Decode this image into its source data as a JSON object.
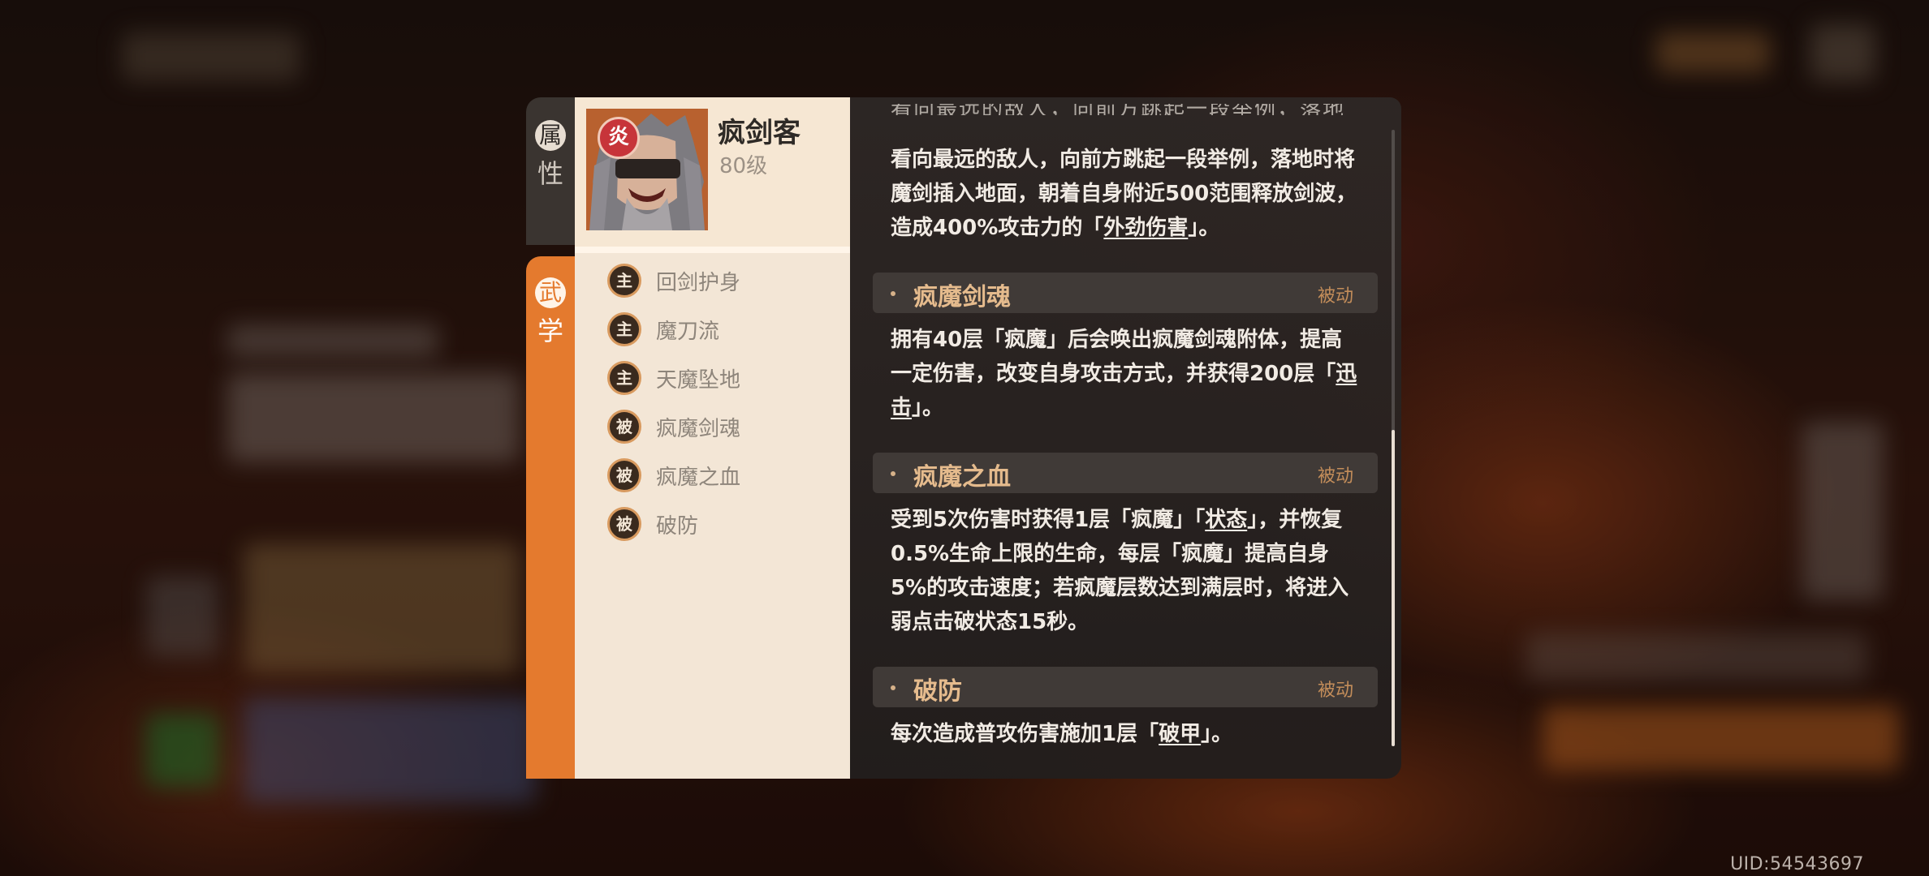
{
  "tabs": {
    "attributes": {
      "char1": "属",
      "char2": "性"
    },
    "martial": {
      "char1": "武",
      "char2": "学"
    }
  },
  "character": {
    "element_badge": "炎",
    "name": "疯剑客",
    "level": "80级"
  },
  "skills": [
    {
      "type": "主",
      "name": "回剑护身"
    },
    {
      "type": "主",
      "name": "魔刀流"
    },
    {
      "type": "主",
      "name": "天魔坠地"
    },
    {
      "type": "被",
      "name": "疯魔剑魂"
    },
    {
      "type": "被",
      "name": "疯魔之血"
    },
    {
      "type": "被",
      "name": "破防"
    }
  ],
  "detail": {
    "cut_line": "看向最远的敌人，向前方跳起一段举例，落地时",
    "intro": {
      "p1": "看向最远的敌人，向前方跳起一段举例，落地时将魔剑插入地面，朝着自身附近500范围释放剑波，造成400%攻击力的「",
      "link1": "外劲伤害",
      "p2": "」。"
    },
    "sections": [
      {
        "title": "疯魔剑魂",
        "tag": "被动",
        "p1": "拥有40层「疯魔」后会唤出疯魔剑魂附体，提高一定伤害，改变自身攻击方式，并获得200层「",
        "link1": "迅击",
        "p2": "」。"
      },
      {
        "title": "疯魔之血",
        "tag": "被动",
        "p1": "受到5次伤害时获得1层「疯魔」「",
        "link1": "状态",
        "p2": "」，并恢复0.5%生命上限的生命，每层「疯魔」提高自身5%的攻击速度；若疯魔层数达到满层时，将进入弱点击破状态15秒。"
      },
      {
        "title": "破防",
        "tag": "被动",
        "p1": "每次造成普攻伤害施加1层「",
        "link1": "破甲",
        "p2": "」。"
      }
    ]
  },
  "footer": {
    "uid": "UID:54543697"
  }
}
